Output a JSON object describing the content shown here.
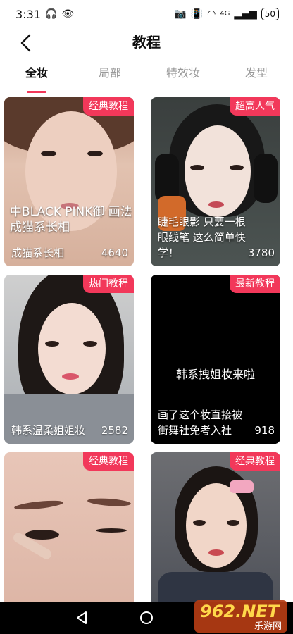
{
  "status_bar": {
    "time": "3:31",
    "battery": "50",
    "network": "4G"
  },
  "header": {
    "title": "教程"
  },
  "tabs": [
    {
      "label": "全妆",
      "active": true
    },
    {
      "label": "局部",
      "active": false
    },
    {
      "label": "特效妆",
      "active": false
    },
    {
      "label": "发型",
      "active": false
    }
  ],
  "cards": [
    {
      "badge": "经典教程",
      "overlay": "中BLACK PINK御 画法成猫系长相",
      "caption": "成猫系长相",
      "count": "4640"
    },
    {
      "badge": "超高人气",
      "caption": "睫毛眼影 只要一根眼线笔 这么简单快学！",
      "count": "3780"
    },
    {
      "badge": "热门教程",
      "caption": "韩系温柔姐姐妆",
      "count": "2582"
    },
    {
      "badge": "最新教程",
      "center_text": "韩系拽姐妆来啦",
      "caption": "画了这个妆直接被街舞社免考入社",
      "count": "918"
    },
    {
      "badge": "经典教程"
    },
    {
      "badge": "经典教程"
    }
  ],
  "watermark": {
    "big": "962.NET",
    "small": "乐游网"
  },
  "colors": {
    "accent": "#f2385a"
  }
}
